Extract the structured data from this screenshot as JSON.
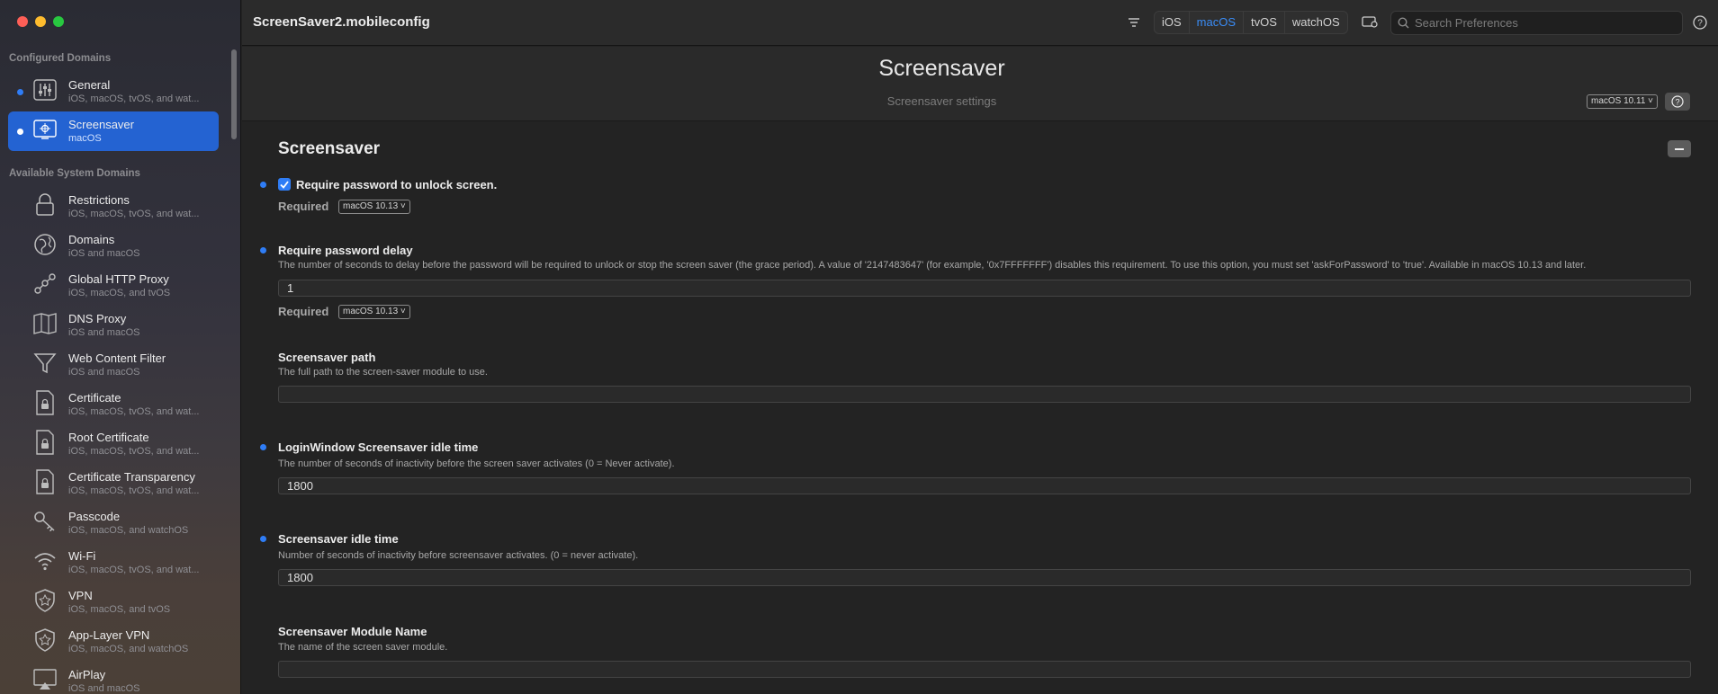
{
  "window": {
    "document_title": "ScreenSaver2.mobileconfig"
  },
  "toolbar": {
    "platforms": [
      "iOS",
      "macOS",
      "tvOS",
      "watchOS"
    ],
    "active_platform": "macOS",
    "search_placeholder": "Search Preferences"
  },
  "sidebar": {
    "configured_title": "Configured Domains",
    "available_title": "Available System Domains",
    "configured": [
      {
        "title": "General",
        "subtitle": "iOS, macOS, tvOS, and wat...",
        "icon": "sliders-icon",
        "enabled": true
      },
      {
        "title": "Screensaver",
        "subtitle": "macOS",
        "icon": "screensaver-icon",
        "enabled": true,
        "selected": true
      }
    ],
    "available": [
      {
        "title": "Restrictions",
        "subtitle": "iOS, macOS, tvOS, and wat...",
        "icon": "lock-icon"
      },
      {
        "title": "Domains",
        "subtitle": "iOS and macOS",
        "icon": "globe-icon"
      },
      {
        "title": "Global HTTP Proxy",
        "subtitle": "iOS, macOS, and tvOS",
        "icon": "network-nodes-icon"
      },
      {
        "title": "DNS Proxy",
        "subtitle": "iOS and macOS",
        "icon": "map-icon"
      },
      {
        "title": "Web Content Filter",
        "subtitle": "iOS and macOS",
        "icon": "filter-funnel-icon"
      },
      {
        "title": "Certificate",
        "subtitle": "iOS, macOS, tvOS, and wat...",
        "icon": "certificate-doc-icon"
      },
      {
        "title": "Root Certificate",
        "subtitle": "iOS, macOS, tvOS, and wat...",
        "icon": "root-certificate-doc-icon"
      },
      {
        "title": "Certificate Transparency",
        "subtitle": "iOS, macOS, tvOS, and wat...",
        "icon": "certificate-transparency-doc-icon"
      },
      {
        "title": "Passcode",
        "subtitle": "iOS, macOS, and watchOS",
        "icon": "key-icon"
      },
      {
        "title": "Wi-Fi",
        "subtitle": "iOS, macOS, tvOS, and wat...",
        "icon": "wifi-icon"
      },
      {
        "title": "VPN",
        "subtitle": "iOS, macOS, and tvOS",
        "icon": "vpn-shield-icon"
      },
      {
        "title": "App-Layer VPN",
        "subtitle": "iOS, macOS, and watchOS",
        "icon": "app-vpn-shield-icon"
      },
      {
        "title": "AirPlay",
        "subtitle": "iOS and macOS",
        "icon": "airplay-icon"
      }
    ]
  },
  "header": {
    "title": "Screensaver",
    "subtitle": "Screensaver settings",
    "version_badge": "macOS  10.11 ˅"
  },
  "section": {
    "title": "Screensaver"
  },
  "fields": {
    "ask_password": {
      "label": "Require password to unlock screen.",
      "checked": true,
      "required_label": "Required",
      "version": "macOS  10.13 ˅"
    },
    "password_delay": {
      "label": "Require password delay",
      "description": "The number of seconds to delay before the password will be required to unlock or stop the screen saver (the grace period). A value of '2147483647' (for example, '0x7FFFFFFF') disables this requirement. To use this option, you must set 'askForPassword' to 'true'. Available in macOS 10.13 and later.",
      "value": "1",
      "required_label": "Required",
      "version": "macOS  10.13 ˅"
    },
    "module_path": {
      "label": "Screensaver path",
      "description": "The full path to the screen-saver module to use.",
      "value": ""
    },
    "loginwindow_idle": {
      "label": "LoginWindow Screensaver idle time",
      "description": "The number of seconds of inactivity before the screen saver activates (0 = Never activate).",
      "value": "1800"
    },
    "idle_time": {
      "label": "Screensaver idle time",
      "description": "Number of seconds of inactivity before screensaver activates. (0 = never activate).",
      "value": "1800"
    },
    "module_name": {
      "label": "Screensaver Module Name",
      "description": "The name of the screen saver module.",
      "value": ""
    }
  },
  "colors": {
    "accent": "#2f7df6",
    "selection": "#2463d2"
  }
}
